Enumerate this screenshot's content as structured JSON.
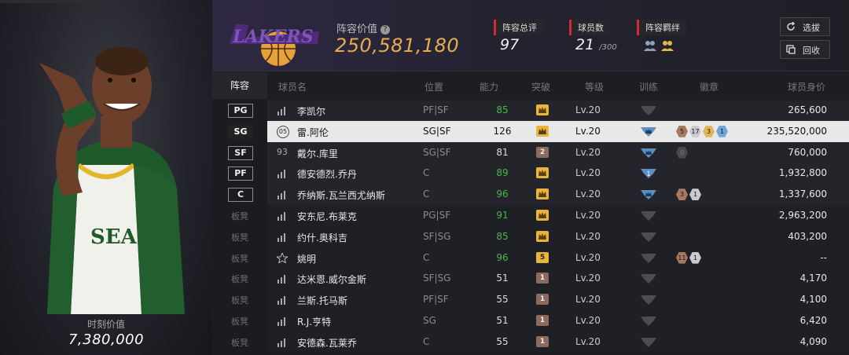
{
  "left_panel": {
    "moment_value_label": "时刻价值",
    "moment_value": "7,380,000"
  },
  "header": {
    "lineup_value_label": "阵容价值",
    "lineup_value": "250,581,180",
    "stats": [
      {
        "label": "阵容总评",
        "value": "97",
        "suffix": ""
      },
      {
        "label": "球员数",
        "value": "21",
        "suffix": "/300"
      },
      {
        "label": "阵容羁绊",
        "value": "",
        "suffix": ""
      }
    ],
    "buttons": {
      "select": "选拔",
      "recycle": "回收"
    },
    "team_logo_icon": "lakers-logo-icon"
  },
  "columns": [
    "阵容",
    "球员名",
    "位置",
    "能力",
    "突破",
    "等级",
    "训练",
    "徽章",
    "球员身价"
  ],
  "rows": [
    {
      "slot": "PG",
      "bench": false,
      "selected": false,
      "role_icon": "signal-bars-icon",
      "name": "李凯尔",
      "position": "PF|SF",
      "ability": "85",
      "ability_color": "green",
      "breakthrough": "crown",
      "bt_color": "gold",
      "level": "Lv.20",
      "training": "dark",
      "medals": [],
      "price": "265,600"
    },
    {
      "slot": "SG",
      "bench": false,
      "selected": true,
      "role_icon": "number-badge-icon",
      "role_num": "05",
      "name": "雷.阿伦",
      "position": "SG|SF",
      "ability": "126",
      "ability_color": "white",
      "breakthrough": "crown",
      "bt_color": "gold",
      "level": "Lv.20",
      "training": "blue-crown",
      "medals": [
        {
          "t": "5",
          "c": "bronze"
        },
        {
          "t": "17",
          "c": "silver"
        },
        {
          "t": "3",
          "c": "gold"
        },
        {
          "t": "1",
          "c": "blue"
        }
      ],
      "price": "235,520,000"
    },
    {
      "slot": "SF",
      "bench": false,
      "selected": false,
      "role_icon": "number-text-icon",
      "role_num": "93",
      "name": "戴尔.库里",
      "position": "SG|SF",
      "ability": "81",
      "ability_color": "white",
      "breakthrough": "2",
      "bt_color": "bronze",
      "level": "Lv.20",
      "training": "blue-crown",
      "medals": [
        {
          "t": "0",
          "c": "grey"
        }
      ],
      "price": "760,000"
    },
    {
      "slot": "PF",
      "bench": false,
      "selected": false,
      "role_icon": "signal-bars-icon",
      "name": "德安德烈.乔丹",
      "position": "C",
      "ability": "89",
      "ability_color": "green",
      "breakthrough": "crown",
      "bt_color": "gold",
      "level": "Lv.20",
      "training": "blue-1",
      "medals": [],
      "price": "1,932,800"
    },
    {
      "slot": "C",
      "bench": false,
      "selected": false,
      "role_icon": "signal-bars-icon",
      "name": "乔纳斯.瓦兰西尤纳斯",
      "position": "C",
      "ability": "96",
      "ability_color": "green",
      "breakthrough": "crown",
      "bt_color": "gold",
      "level": "Lv.20",
      "training": "blue-crown",
      "medals": [
        {
          "t": "3",
          "c": "bronze"
        },
        {
          "t": "1",
          "c": "silver"
        }
      ],
      "price": "1,337,600"
    },
    {
      "slot": "板凳",
      "bench": true,
      "selected": false,
      "role_icon": "signal-bars-icon",
      "name": "安东尼.布莱克",
      "position": "PG|SF",
      "ability": "91",
      "ability_color": "green",
      "breakthrough": "crown",
      "bt_color": "gold",
      "level": "Lv.20",
      "training": "dark",
      "medals": [],
      "price": "2,963,200"
    },
    {
      "slot": "板凳",
      "bench": true,
      "selected": false,
      "role_icon": "signal-bars-icon",
      "name": "约什.奥科吉",
      "position": "SF|SG",
      "ability": "85",
      "ability_color": "green",
      "breakthrough": "crown",
      "bt_color": "gold",
      "level": "Lv.20",
      "training": "dark",
      "medals": [],
      "price": "403,200"
    },
    {
      "slot": "板凳",
      "bench": true,
      "selected": false,
      "role_icon": "star-icon",
      "name": "姚明",
      "position": "C",
      "ability": "96",
      "ability_color": "green",
      "breakthrough": "5",
      "bt_color": "gold",
      "level": "Lv.20",
      "training": "dark",
      "medals": [
        {
          "t": "11",
          "c": "bronze"
        },
        {
          "t": "1",
          "c": "silver"
        }
      ],
      "price": "--"
    },
    {
      "slot": "板凳",
      "bench": true,
      "selected": false,
      "role_icon": "signal-bars-icon",
      "name": "达米恩.威尔金斯",
      "position": "SF|SG",
      "ability": "51",
      "ability_color": "white",
      "breakthrough": "1",
      "bt_color": "bronze",
      "level": "Lv.20",
      "training": "dark",
      "medals": [],
      "price": "4,170"
    },
    {
      "slot": "板凳",
      "bench": true,
      "selected": false,
      "role_icon": "signal-bars-icon",
      "name": "兰斯.托马斯",
      "position": "PF|SF",
      "ability": "55",
      "ability_color": "white",
      "breakthrough": "1",
      "bt_color": "bronze",
      "level": "Lv.20",
      "training": "dark",
      "medals": [],
      "price": "4,100"
    },
    {
      "slot": "板凳",
      "bench": true,
      "selected": false,
      "role_icon": "signal-bars-icon",
      "name": "R.J.亨特",
      "position": "SG",
      "ability": "51",
      "ability_color": "white",
      "breakthrough": "1",
      "bt_color": "bronze",
      "level": "Lv.20",
      "training": "dark",
      "medals": [],
      "price": "6,420"
    },
    {
      "slot": "板凳",
      "bench": true,
      "selected": false,
      "role_icon": "signal-bars-icon",
      "name": "安德森.瓦莱乔",
      "position": "C",
      "ability": "55",
      "ability_color": "white",
      "breakthrough": "1",
      "bt_color": "bronze",
      "level": "Lv.20",
      "training": "dark",
      "medals": [],
      "price": "4,090"
    }
  ],
  "colors": {
    "accent_gold": "#e3ad4f",
    "stat_red": "#d02a3a",
    "ability_green": "#49b64b"
  }
}
